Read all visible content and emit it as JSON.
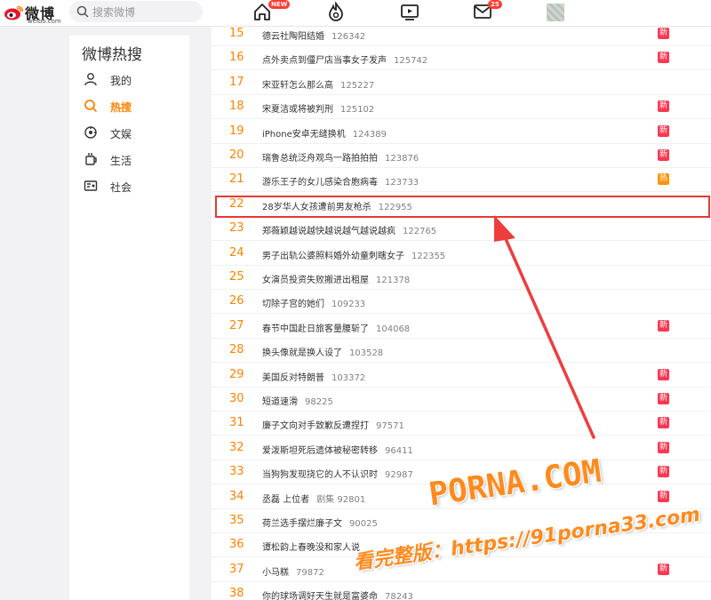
{
  "header": {
    "logo_text": "微博",
    "logo_sub": "weibo.com",
    "search_placeholder": "搜索微博",
    "nav": [
      {
        "icon": "home-icon",
        "badge": "NEW"
      },
      {
        "icon": "fire-icon",
        "badge": ""
      },
      {
        "icon": "video-icon",
        "badge": ""
      },
      {
        "icon": "mail-icon",
        "badge": "25"
      }
    ]
  },
  "sidebar": {
    "title": "微博热搜",
    "items": [
      {
        "label": "我的",
        "icon": "user-icon",
        "active": false
      },
      {
        "label": "热搜",
        "icon": "search-icon",
        "active": true
      },
      {
        "label": "文娱",
        "icon": "entertainment-icon",
        "active": false
      },
      {
        "label": "生活",
        "icon": "life-icon",
        "active": false
      },
      {
        "label": "社会",
        "icon": "society-icon",
        "active": false
      }
    ]
  },
  "hot_list": [
    {
      "rank": "15",
      "title": "德云社陶阳结婚",
      "heat": "126342",
      "tag": "新"
    },
    {
      "rank": "16",
      "title": "点外卖点到僵尸店当事女子发声",
      "heat": "125742",
      "tag": "新"
    },
    {
      "rank": "17",
      "title": "宋亚轩怎么那么高",
      "heat": "125227",
      "tag": ""
    },
    {
      "rank": "18",
      "title": "宋夏洁或将被判刑",
      "heat": "125102",
      "tag": "新"
    },
    {
      "rank": "19",
      "title": "iPhone安卓无缝换机",
      "heat": "124389",
      "tag": "新"
    },
    {
      "rank": "20",
      "title": "瑞鲁总统泛舟观鸟一路拍拍拍",
      "heat": "123876",
      "tag": "新"
    },
    {
      "rank": "21",
      "title": "游乐王子的女儿感染合胞病毒",
      "heat": "123733",
      "tag": "热"
    },
    {
      "rank": "22",
      "title": "28岁华人女孩遭前男友枪杀",
      "heat": "122955",
      "tag": ""
    },
    {
      "rank": "23",
      "title": "郑薇颖越说越快越说越气越说越疯",
      "heat": "122765",
      "tag": ""
    },
    {
      "rank": "24",
      "title": "男子出轨公婆照料婚外幼童刺瞎女子",
      "heat": "122355",
      "tag": ""
    },
    {
      "rank": "25",
      "title": "女演员投资失败搬进出租屋",
      "heat": "121378",
      "tag": ""
    },
    {
      "rank": "26",
      "title": "切除子宫的她们",
      "heat": "109233",
      "tag": ""
    },
    {
      "rank": "27",
      "title": "春节中国赴日旅客量腰斩了",
      "heat": "104068",
      "tag": "新"
    },
    {
      "rank": "28",
      "title": "换头像就是换人设了",
      "heat": "103528",
      "tag": ""
    },
    {
      "rank": "29",
      "title": "美国反对特朗普",
      "heat": "103372",
      "tag": "新"
    },
    {
      "rank": "30",
      "title": "短道速滑",
      "heat": "98225",
      "tag": "新"
    },
    {
      "rank": "31",
      "title": "廉子文向对手致歉反遭捏打",
      "heat": "97571",
      "tag": "新"
    },
    {
      "rank": "32",
      "title": "爱泼斯坦死后遗体被秘密转移",
      "heat": "96411",
      "tag": "新"
    },
    {
      "rank": "33",
      "title": "当狗狗发现挠它的人不认识时",
      "heat": "92987",
      "tag": "新"
    },
    {
      "rank": "34",
      "title": "丞磊 上位者",
      "heat": "剧集 92801",
      "tag": "新"
    },
    {
      "rank": "35",
      "title": "荷兰选手摆烂廉子文",
      "heat": "90025",
      "tag": ""
    },
    {
      "rank": "36",
      "title": "谭松韵上春晚没和家人说",
      "heat": "",
      "tag": ""
    },
    {
      "rank": "37",
      "title": "小马糕",
      "heat": "79872",
      "tag": "新"
    },
    {
      "rank": "38",
      "title": "你的球场调好天生就是富婆命",
      "heat": "78243",
      "tag": ""
    }
  ],
  "watermark": {
    "line1": "PORNA.COM",
    "line2": "看完整版：https://91porna33.com"
  },
  "colors": {
    "accent": "#ff8200",
    "highlight": "#e53935",
    "new_tag": "#ff3852",
    "hot_tag": "#ff9406"
  }
}
